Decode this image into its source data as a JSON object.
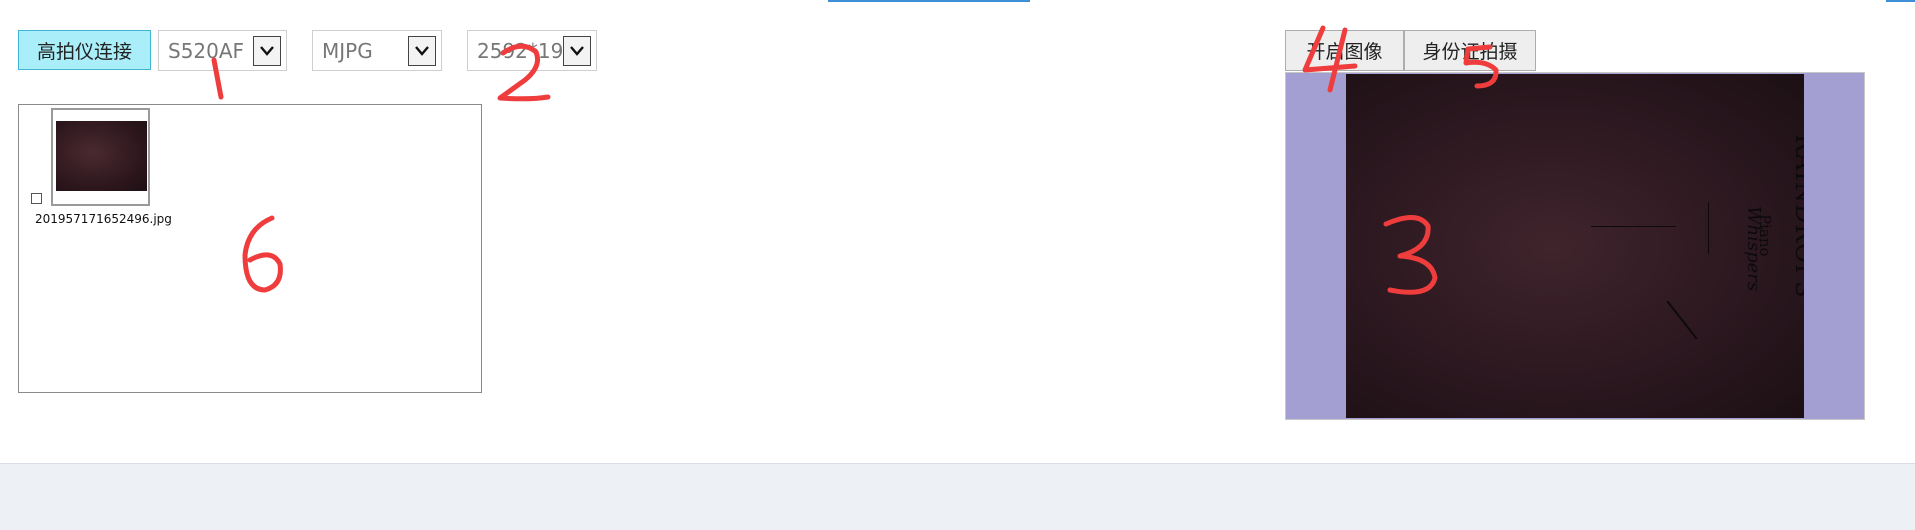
{
  "toolbar": {
    "connect_label": "高拍仪连接",
    "device_select": {
      "value": "S520AF"
    },
    "format_select": {
      "value": "MJPG"
    },
    "resolution_select": {
      "value": "2592*19"
    }
  },
  "thumbnails": {
    "items": [
      {
        "filename": "201957171652496.jpg",
        "checked": false
      }
    ]
  },
  "preview": {
    "open_image_label": "开启图像",
    "id_capture_label": "身份证拍摄",
    "placeholder_bg": "#a39fd3",
    "book": {
      "title": "RAINDROPS",
      "subtitle": "Whispers",
      "tag": "Piano"
    }
  },
  "annotations": [
    {
      "label": "1",
      "color": "#ef3d3d"
    },
    {
      "label": "2",
      "color": "#ef3d3d"
    },
    {
      "label": "3",
      "color": "#ef3d3d"
    },
    {
      "label": "4",
      "color": "#ef3d3d"
    },
    {
      "label": "5",
      "color": "#ef3d3d"
    },
    {
      "label": "6",
      "color": "#ef3d3d"
    }
  ]
}
